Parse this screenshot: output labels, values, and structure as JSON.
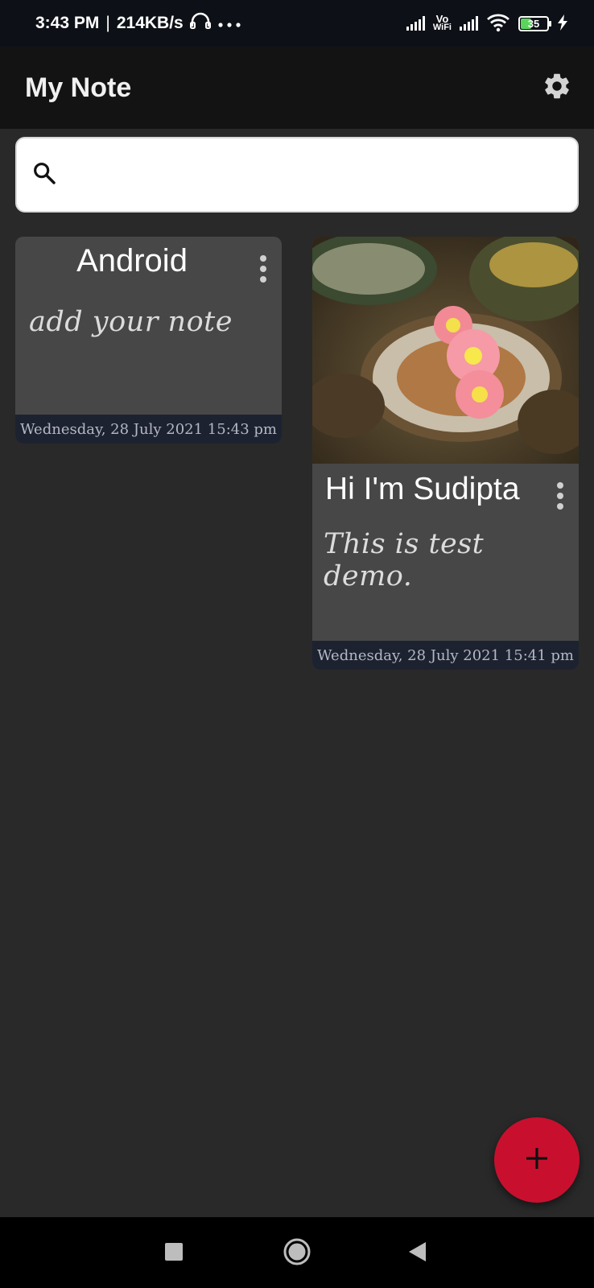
{
  "status_bar": {
    "time": "3:43 PM",
    "separator": "|",
    "speed": "214KB/s",
    "vowifi_top": "Vo",
    "vowifi_bottom": "WiFi",
    "battery": "35"
  },
  "app_bar": {
    "title": "My Note"
  },
  "search": {
    "value": "",
    "placeholder": ""
  },
  "notes": [
    {
      "title": "Android",
      "body": "add your note",
      "date": "Wednesday, 28 July 2021 15:43 pm",
      "has_image": false
    },
    {
      "title": "Hi I'm Sudipta",
      "body": "This is test demo.",
      "date": "Wednesday, 28 July 2021 15:41 pm",
      "has_image": true
    }
  ],
  "colors": {
    "background": "#292929",
    "app_bar": "#131313",
    "card": "#474747",
    "date_strip": "#1d2230",
    "fab": "#c8102e",
    "battery_fill": "#5cd35c"
  },
  "icons": [
    "headset-icon",
    "more-dots-icon",
    "signal-icon",
    "wifi-icon",
    "battery-icon",
    "charging-icon",
    "settings-gear-icon",
    "search-icon",
    "kebab-menu-icon",
    "add-icon",
    "recent-apps-icon",
    "home-icon",
    "back-icon"
  ]
}
